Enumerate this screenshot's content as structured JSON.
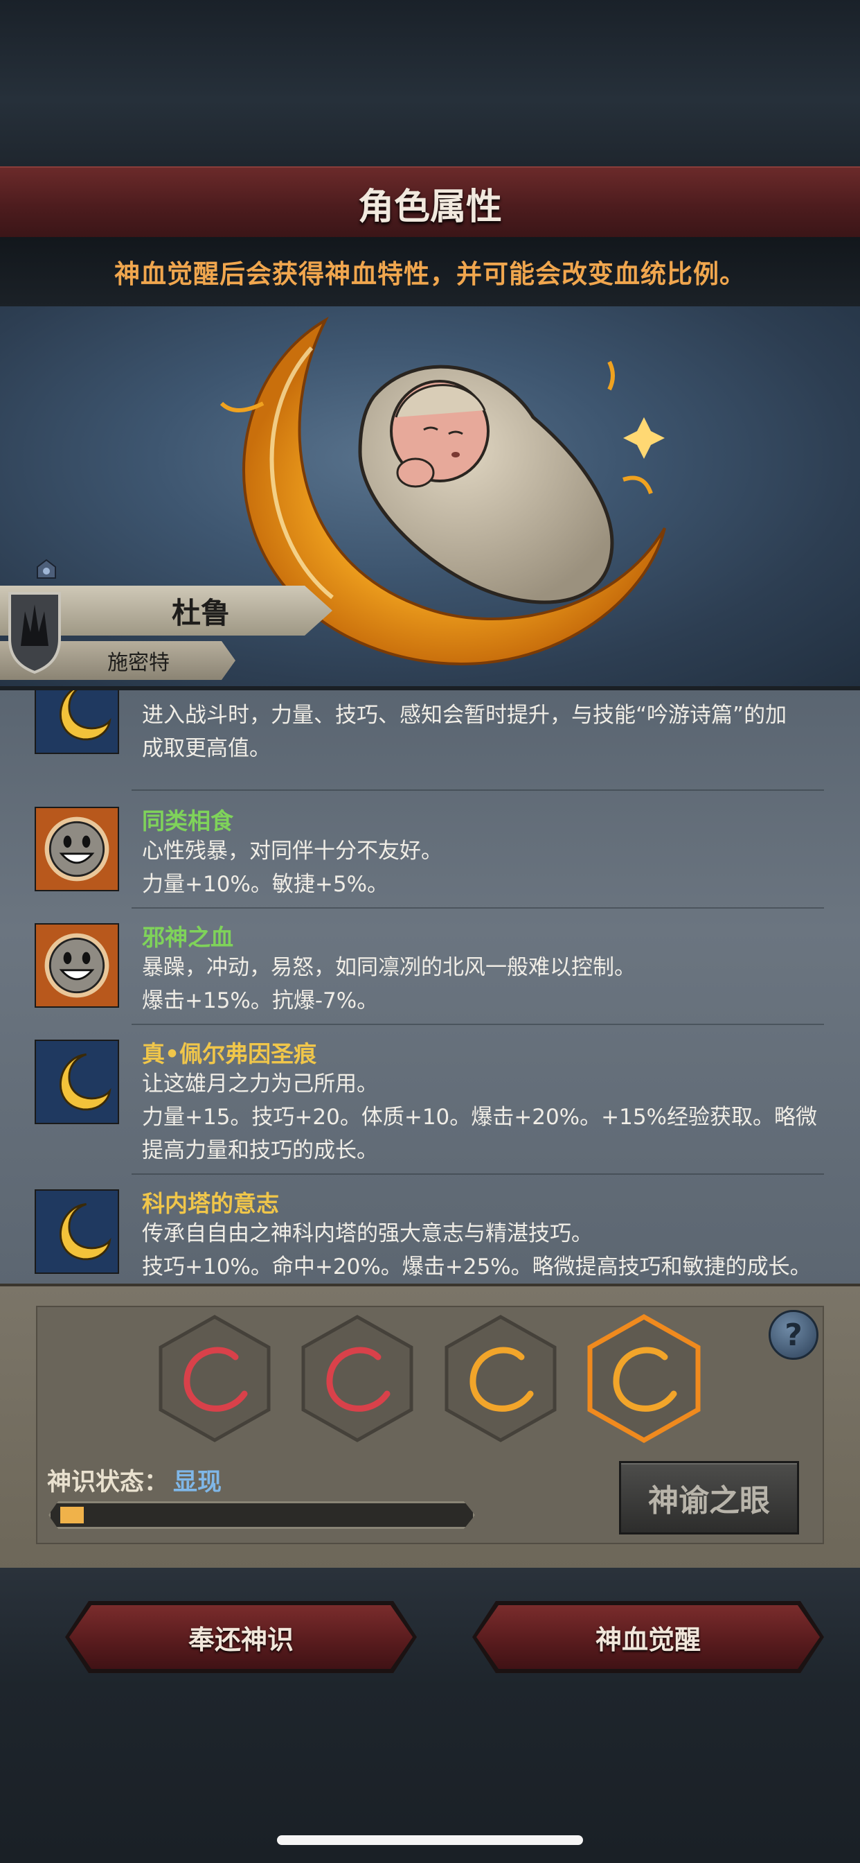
{
  "header": {
    "title": "角色属性",
    "notice": "神血觉醒后会获得神血特性，并可能会改变血统比例。"
  },
  "character": {
    "name": "杜鲁",
    "class": "施密特"
  },
  "traits": [
    {
      "name": "",
      "icon": "crescent-moon-icon",
      "lines": [
        "进入战斗时，力量、技巧、感知会暂时提升，与技能“吟游诗篇”的加",
        "成取更高值。"
      ]
    },
    {
      "name": "同类相食",
      "name_color": "#7fd35a",
      "icon": "grinning-face-icon",
      "lines": [
        "心性残暴，对同伴十分不友好。",
        "力量+10%。敏捷+5%。"
      ]
    },
    {
      "name": "邪神之血",
      "name_color": "#7fd35a",
      "icon": "grinning-face-icon",
      "lines": [
        "暴躁，冲动，易怒，如同凛冽的北风一般难以控制。",
        "爆击+15%。抗爆-7%。"
      ]
    },
    {
      "name": "真•佩尔弗因圣痕",
      "name_color": "#f0c64a",
      "icon": "crescent-moon-icon",
      "lines": [
        "让这雄月之力为己所用。",
        "力量+15。技巧+20。体质+10。爆击+20%。+15%经验获取。略微",
        "提高力量和技巧的成长。"
      ]
    },
    {
      "name": "科内塔的意志",
      "name_color": "#f0c64a",
      "icon": "crescent-moon-icon",
      "lines": [
        "传承自自由之神科内塔的强大意志与精湛技巧。",
        "技巧+10%。命中+20%。爆击+25%。略微提高技巧和敏捷的成长。"
      ]
    }
  ],
  "divinity": {
    "status_label": "神识状态：",
    "status_value": "显现",
    "progress": 0.04,
    "slots": [
      {
        "icon": "red-crescent-icon",
        "color": "#d9414a"
      },
      {
        "icon": "red-crescent-icon",
        "color": "#d9414a"
      },
      {
        "icon": "gold-crescent-icon",
        "color": "#f2a52a"
      },
      {
        "icon": "gold-crescent-icon",
        "color": "#f2a52a",
        "selected": true
      }
    ],
    "help_label": "?",
    "oracle_button": "神谕之眼"
  },
  "actions": {
    "return_button": "奉还神识",
    "awaken_button": "神血觉醒"
  },
  "colors": {
    "accent_orange": "#f0a64e",
    "title_red": "#5a1c1e",
    "status_blue": "#7fb7e8"
  }
}
